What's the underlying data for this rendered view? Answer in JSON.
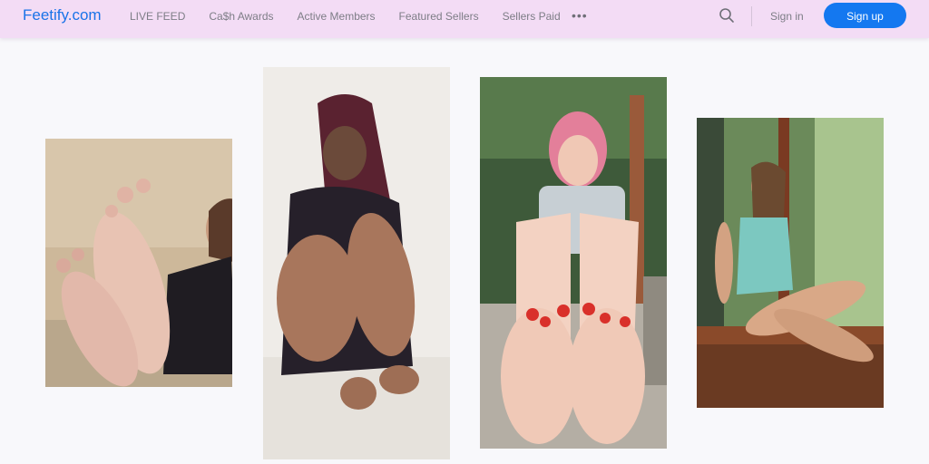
{
  "header": {
    "logo": "Feetify.com",
    "nav": [
      "LIVE FEED",
      "Ca$h Awards",
      "Active Members",
      "Featured Sellers",
      "Sellers Paid"
    ],
    "more": "•••",
    "signin": "Sign in",
    "signup": "Sign up"
  },
  "colors": {
    "header_bg": "#f3dcf5",
    "brand": "#1a73e8",
    "signup_bg": "#1478f0",
    "page_bg": "#f8f8fb"
  },
  "icons": {
    "search": "search-icon",
    "more": "more-dots-icon"
  },
  "gallery": [
    {
      "photo": "woman-soles-raised-beige-wall"
    },
    {
      "photo": "woman-braids-sitting-white-floor"
    },
    {
      "photo": "woman-pink-hair-soles-outdoor-deck"
    },
    {
      "photo": "woman-swimsuit-sitting-window-ledge"
    }
  ]
}
